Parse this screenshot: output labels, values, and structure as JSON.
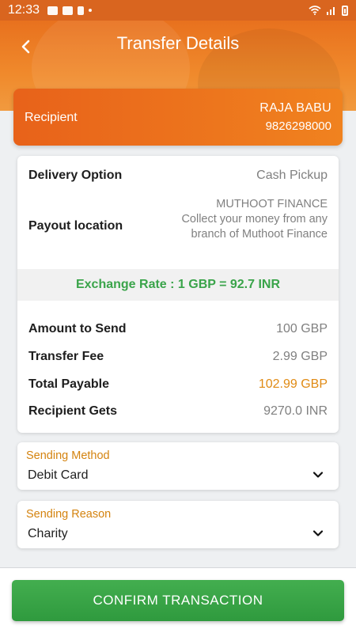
{
  "status_bar": {
    "time": "12:33",
    "icons_left": [
      "image-icon",
      "mail-icon",
      "finger-icon",
      "dots-icon"
    ],
    "icons_right": [
      "wifi-icon",
      "signal-icon",
      "battery-icon"
    ]
  },
  "header": {
    "title": "Transfer Details",
    "back_icon": "back-arrow-icon"
  },
  "recipient": {
    "label": "Recipient",
    "name": "RAJA BABU",
    "phone": "9826298000"
  },
  "details": {
    "delivery_option": {
      "label": "Delivery Option",
      "value": "Cash Pickup"
    },
    "payout_location": {
      "label": "Payout location",
      "value_line1": "MUTHOOT FINANCE",
      "value_line2": "Collect your money from any branch of Muthoot Finance"
    },
    "exchange_rate": "Exchange Rate : 1 GBP = 92.7 INR",
    "amount_to_send": {
      "label": "Amount to Send",
      "value": "100 GBP"
    },
    "transfer_fee": {
      "label": "Transfer Fee",
      "value": "2.99 GBP"
    },
    "total_payable": {
      "label": "Total Payable",
      "value": "102.99 GBP"
    },
    "recipient_gets": {
      "label": "Recipient Gets",
      "value": "9270.0 INR"
    }
  },
  "sending_method": {
    "label": "Sending Method",
    "value": "Debit Card"
  },
  "sending_reason": {
    "label": "Sending Reason",
    "value": "Charity"
  },
  "confirm_button": {
    "label": "CONFIRM TRANSACTION"
  },
  "colors": {
    "header_orange": "#e8711e",
    "accent_orange": "#e08a13",
    "exchange_green": "#3aa44a",
    "button_green": "#3aa546"
  }
}
